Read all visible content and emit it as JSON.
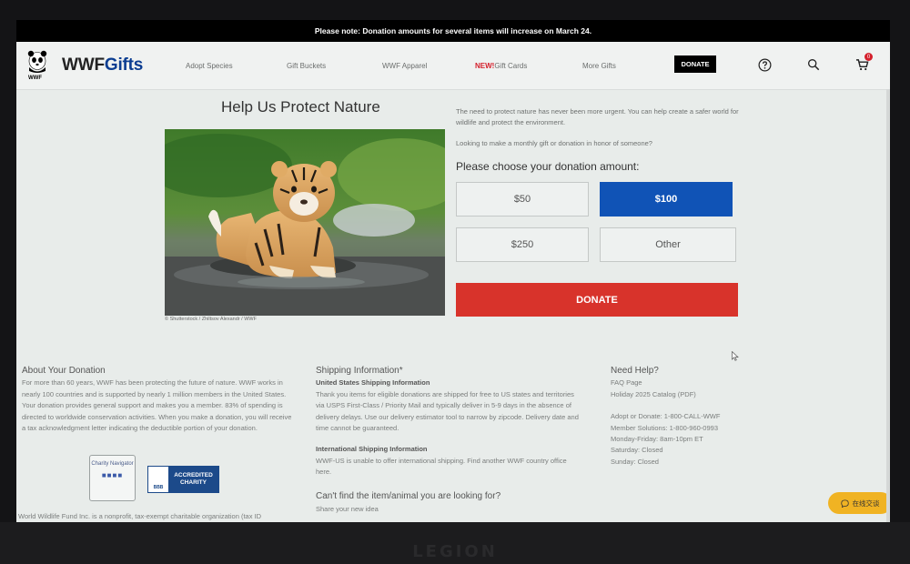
{
  "notice": "Please note: Donation amounts for several items will increase on March 24.",
  "header": {
    "logo_small": "WWF",
    "brand_wwf": "WWF",
    "brand_gifts": "Gifts",
    "nav": [
      "Adopt Species",
      "Gift Buckets",
      "WWF Apparel",
      "Gift Cards",
      "More Gifts"
    ],
    "new_tag": "NEW!",
    "donate_label": "DONATE",
    "cart_count": "0",
    "icons": [
      "help-icon",
      "search-icon",
      "cart-icon"
    ]
  },
  "main": {
    "title": "Help Us Protect Nature",
    "photo_credit": "© Shutterstock / Zhiltsov Alexandr / WWF",
    "intro": "The need to protect nature has never been more urgent. You can help create a safer world for wildlife and protect the environment.",
    "monthly_prompt": "Looking to make a monthly gift or donation in honor of someone?",
    "choose_label": "Please choose your donation amount:",
    "amounts": [
      "$50",
      "$100",
      "$250",
      "Other"
    ],
    "selected_amount": "$100",
    "donate_label": "DONATE"
  },
  "about": {
    "heading": "About Your Donation",
    "text": "For more than 60 years, WWF has been protecting the future of nature. WWF works in nearly 100 countries and is supported by nearly 1 million members in the United States. Your donation provides general support and makes you a member. 83% of spending is directed to worldwide conservation activities. When you make a donation, you will receive a tax acknowledgment letter indicating the deductible portion of your donation.",
    "charity_navigator": "Charity Navigator",
    "bbb_label": "BBB",
    "bbb_text": "ACCREDITED CHARITY",
    "footer_cut": "World Wildlife Fund Inc. is a nonprofit, tax-exempt charitable organization (tax ID"
  },
  "shipping": {
    "heading": "Shipping Information*",
    "us_heading": "United States Shipping Information",
    "us_text": "Thank you items for eligible donations are shipped for free to US states and territories via USPS First-Class / Priority Mail and typically deliver in 5-9 days in the absence of delivery delays. Use our delivery estimator tool to narrow by zipcode. Delivery date and time cannot be guaranteed.",
    "intl_heading": "International Shipping Information",
    "intl_text": "WWF-US is unable to offer international shipping. Find another WWF country office here.",
    "cant_find": "Can't find the item/animal you are looking for?",
    "share": "Share your new idea"
  },
  "help": {
    "heading": "Need Help?",
    "faq": "FAQ Page",
    "catalog": "Holiday 2025 Catalog (PDF)",
    "phone": "Adopt or Donate: 1-800-CALL-WWF",
    "member": "Member Solutions: 1-800-960-0993",
    "hours_weekday": "Monday-Friday: 8am-10pm ET",
    "hours_sat": "Saturday: Closed",
    "hours_sun": "Sunday: Closed"
  },
  "chat": {
    "label": "在线交谈"
  },
  "device_brand": "LEGION",
  "colors": {
    "selected_blue": "#1053b6",
    "donate_red": "#d8332b",
    "chat_yellow": "#f0b323"
  }
}
